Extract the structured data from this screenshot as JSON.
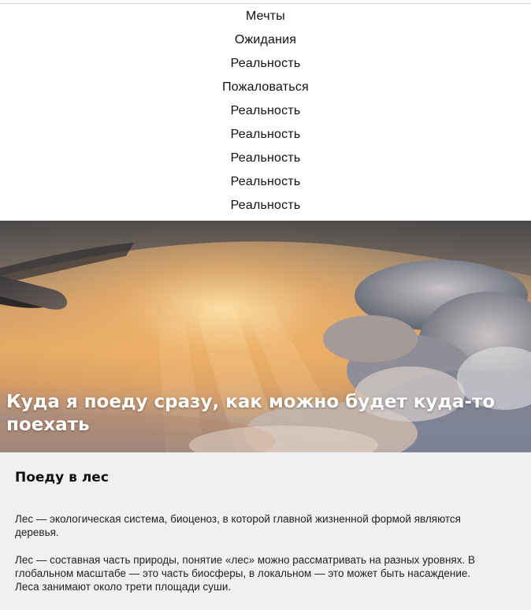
{
  "nav": {
    "items": [
      {
        "label": "Мечты"
      },
      {
        "label": "Ожидания"
      },
      {
        "label": "Реальность"
      },
      {
        "label": "Пожаловаться"
      },
      {
        "label": "Реальность"
      },
      {
        "label": "Реальность"
      },
      {
        "label": "Реальность"
      },
      {
        "label": "Реальность"
      },
      {
        "label": "Реальность"
      }
    ]
  },
  "hero": {
    "title": "Куда я поеду сразу, как можно будет куда-то поехать"
  },
  "article": {
    "title": "Поеду в лес",
    "paragraphs": [
      "Лес — экологическая система, биоценоз, в которой главной жизненной формой являются деревья.",
      "Лес — составная часть природы, понятие «лес» можно рассматривать на разных уровнях. В глобальном масштабе — это часть биосферы, в локальном — это может быть насаждение. Леса занимают около трети площади суши."
    ]
  },
  "colors": {
    "background": "#ffffff",
    "article_background": "#f0f0f0",
    "text": "#111111",
    "hero_title": "#ffffff"
  }
}
